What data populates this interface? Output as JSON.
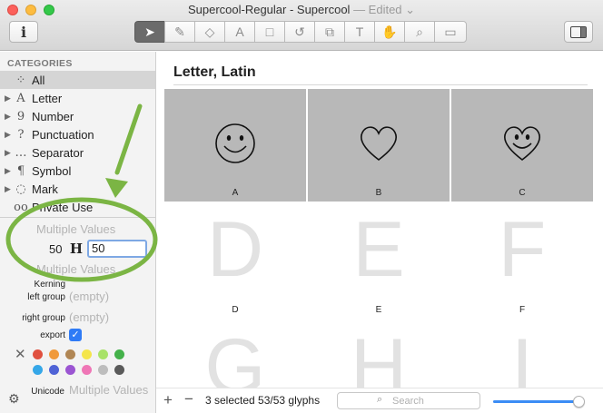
{
  "window": {
    "title": "Supercool-Regular - Supercool",
    "edited": "— Edited ⌄"
  },
  "toolbar": {
    "info_label": "i",
    "tools": [
      {
        "icon": "select-arrow-icon",
        "glyph": "➤"
      },
      {
        "icon": "pen-tool-icon",
        "glyph": "✎"
      },
      {
        "icon": "eraser-icon",
        "glyph": "◇"
      },
      {
        "icon": "shape-text-icon",
        "glyph": "A"
      },
      {
        "icon": "rectangle-icon",
        "glyph": "□"
      },
      {
        "icon": "rotate-icon",
        "glyph": "↺"
      },
      {
        "icon": "scale-icon",
        "glyph": "⧉"
      },
      {
        "icon": "text-tool-icon",
        "glyph": "T"
      },
      {
        "icon": "hand-tool-icon",
        "glyph": "✋"
      },
      {
        "icon": "zoom-icon",
        "glyph": "⌕"
      },
      {
        "icon": "measure-icon",
        "glyph": "▭"
      }
    ]
  },
  "sidebar": {
    "categories_label": "CATEGORIES",
    "items": [
      {
        "label": "All",
        "icon": "grid-icon",
        "glyph": "⁘",
        "expandable": false,
        "selected": true
      },
      {
        "label": "Letter",
        "icon": "letter-icon",
        "glyph": "A",
        "expandable": true,
        "selected": false
      },
      {
        "label": "Number",
        "icon": "number-icon",
        "glyph": "9",
        "expandable": true,
        "selected": false
      },
      {
        "label": "Punctuation",
        "icon": "punctuation-icon",
        "glyph": "?",
        "expandable": true,
        "selected": false
      },
      {
        "label": "Separator",
        "icon": "separator-icon",
        "glyph": "…",
        "expandable": true,
        "selected": false
      },
      {
        "label": "Symbol",
        "icon": "symbol-icon",
        "glyph": "¶",
        "expandable": true,
        "selected": false
      },
      {
        "label": "Mark",
        "icon": "mark-icon",
        "glyph": "◌",
        "expandable": true,
        "selected": false
      },
      {
        "label": "Private Use",
        "icon": "glasses-icon",
        "glyph": "oo",
        "expandable": false,
        "selected": false
      }
    ],
    "info": {
      "multiple_values_top": "Multiple Values",
      "left_metric": "50",
      "right_metric": "50",
      "kern_icon_glyph": "H",
      "multiple_values_bottom": "Multiple Values",
      "kerning_label": "Kerning",
      "left_group_label": "left group",
      "left_group_value": "(empty)",
      "right_group_label": "right group",
      "right_group_value": "(empty)",
      "export_label": "export",
      "export_checked": true,
      "color_swatches": [
        "#e0503f",
        "#f09a3b",
        "#b08654",
        "#f4e54b",
        "#a8e268",
        "#44b14a",
        "#35a7e8",
        "#4f63d6",
        "#9b55d2",
        "#ef76b6",
        "#bdbdbd",
        "#5a5a5a"
      ],
      "unicode_label": "Unicode",
      "unicode_value": "Multiple Values"
    }
  },
  "main": {
    "category_title": "Letter, Latin",
    "glyphs": [
      {
        "name": "A",
        "selected": true,
        "icon": "smiley-face-icon"
      },
      {
        "name": "B",
        "selected": true,
        "icon": "heart-icon"
      },
      {
        "name": "C",
        "selected": true,
        "icon": "smiley-heart-icon"
      },
      {
        "name": "D",
        "selected": false,
        "big": "D"
      },
      {
        "name": "E",
        "selected": false,
        "big": "E"
      },
      {
        "name": "F",
        "selected": false,
        "big": "F"
      },
      {
        "name": "G",
        "selected": false,
        "big": "G"
      },
      {
        "name": "H",
        "selected": false,
        "big": "H"
      },
      {
        "name": "I",
        "selected": false,
        "big": "I"
      }
    ],
    "bottom": {
      "add_label": "+",
      "remove_label": "−",
      "status": "3 selected 53/53 glyphs",
      "search_placeholder": "Search",
      "zoom_level": 0.97
    }
  },
  "annotation": {
    "arrow_color": "#7bb544",
    "ellipse_color": "#7bb544"
  }
}
